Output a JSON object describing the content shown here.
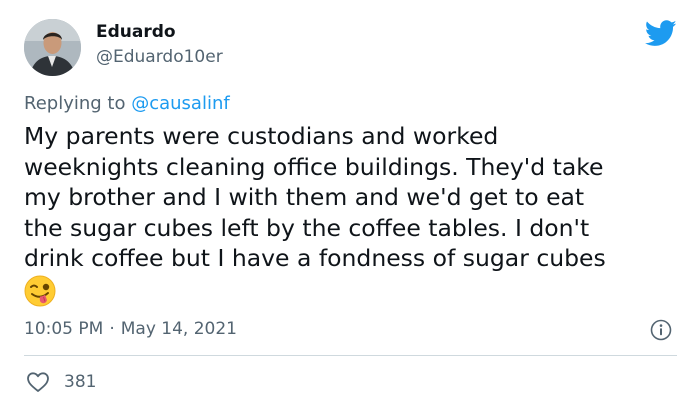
{
  "author": {
    "display_name": "Eduardo",
    "handle": "@Eduardo10er"
  },
  "reply": {
    "prefix": "Replying to ",
    "mention": "@causalinf"
  },
  "tweet": {
    "lines": [
      "My parents were custodians and worked",
      "weeknights cleaning office buildings. They'd take",
      "my brother and I with them and we'd get to eat",
      "the sugar cubes left by the coffee tables. I don't",
      "drink coffee but I have a fondness of sugar cubes"
    ],
    "emoji": "winking-face-with-tongue"
  },
  "meta": {
    "time": "10:05 PM",
    "separator": "·",
    "date": "May 14, 2021"
  },
  "stats": {
    "likes": "381"
  },
  "icons": {
    "brand": "twitter-bird-icon",
    "info": "info-icon",
    "like": "heart-icon"
  },
  "colors": {
    "brand": "#1d9bf0",
    "text": "#0f1419",
    "secondary": "#536471",
    "divider": "#cfd9de"
  }
}
